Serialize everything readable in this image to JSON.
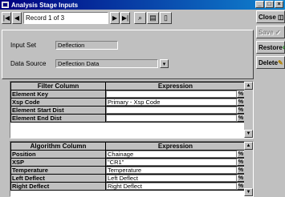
{
  "window": {
    "title": "Analysis Stage Inputs"
  },
  "nav": {
    "record": "Record 1 of 3"
  },
  "side_buttons": {
    "close": "Close",
    "save": "Save",
    "restore": "Restore",
    "delete": "Delete"
  },
  "form": {
    "input_set_label": "Input Set",
    "input_set_value": "Deflection",
    "data_source_label": "Data Source",
    "data_source_value": "Deflection Data"
  },
  "filter_grid": {
    "col1": "Filter Column",
    "col2": "Expression",
    "rows": [
      {
        "name": "Element Key",
        "expr": ""
      },
      {
        "name": "Xsp Code",
        "expr": "Primary - Xsp Code"
      },
      {
        "name": "Element Start Dist",
        "expr": ""
      },
      {
        "name": "Element End Dist",
        "expr": ""
      }
    ]
  },
  "algo_grid": {
    "col1": "Algorithm Column",
    "col2": "Expression",
    "rows": [
      {
        "name": "Position",
        "expr": "Chainage"
      },
      {
        "name": "XSP",
        "expr": "\"CR1\""
      },
      {
        "name": "Temperature",
        "expr": "Temperature"
      },
      {
        "name": "Left Deflect",
        "expr": "Left Deflect"
      },
      {
        "name": "Right Deflect",
        "expr": "Right Deflect"
      }
    ]
  },
  "expr_button_glyph": "%",
  "colors": {
    "title_start": "#000080",
    "title_end": "#1084d0",
    "face": "#c0c0c0"
  }
}
